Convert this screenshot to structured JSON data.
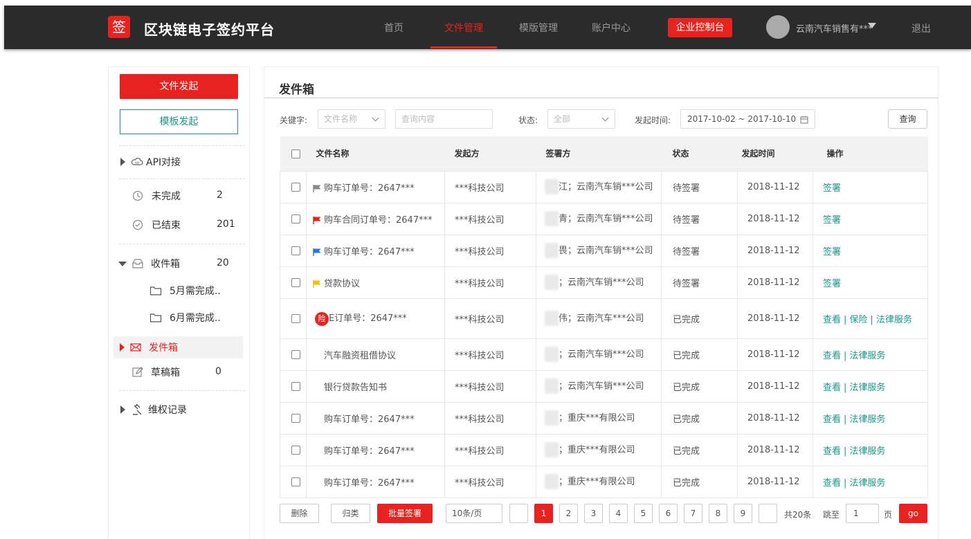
{
  "header": {
    "logo_char": "签",
    "brand": "区块链电子签约平台",
    "nav": [
      {
        "label": "首页",
        "active": false
      },
      {
        "label": "文件管理",
        "active": true
      },
      {
        "label": "模版管理",
        "active": false
      },
      {
        "label": "账户中心",
        "active": false
      }
    ],
    "control_button": "企业控制台",
    "user_name": "云南汽车销售有***",
    "logout": "退出"
  },
  "sidebar": {
    "start_button": "文件发起",
    "template_button": "模板发起",
    "api": "API对接",
    "unfinished": {
      "label": "未完成",
      "count": "2"
    },
    "finished": {
      "label": "已结束",
      "count": "201"
    },
    "inbox": {
      "label": "收件箱",
      "count": "20"
    },
    "folders": [
      "5月需完成..",
      "6月需完成.."
    ],
    "outbox": {
      "label": "发件箱"
    },
    "drafts": {
      "label": "草稿箱",
      "count": "0"
    },
    "rights": "维权记录"
  },
  "main": {
    "title": "发件箱",
    "filters": {
      "keyword_label": "关键字:",
      "keyword_type_placeholder": "文件名称",
      "query_placeholder": "查询内容",
      "status_label": "状态:",
      "status_value": "全部",
      "date_label": "发起时间:",
      "date_value": "2017-10-02 ~ 2017-10-10",
      "query_button": "查询"
    },
    "table": {
      "headers": [
        "文件名称",
        "发起方",
        "签署方",
        "状态",
        "发起时间",
        "操作"
      ],
      "rows": [
        {
          "flag": "#888888",
          "name": "购车订单号：2647***",
          "initiator": "***科技公司",
          "signer": "江；云南汽车销***公司",
          "status": "待签署",
          "date": "2018-11-12",
          "actions": [
            "签署"
          ]
        },
        {
          "flag": "#e8231f",
          "name": "购车合同订单号：2647***",
          "initiator": "***科技公司",
          "signer": "青；云南汽车销***公司",
          "status": "待签署",
          "date": "2018-11-12",
          "actions": [
            "签署"
          ]
        },
        {
          "flag": "#2a72e8",
          "name": "购车订单号：2647***",
          "initiator": "***科技公司",
          "signer": "畏；云南汽车销***公司",
          "status": "待签署",
          "date": "2018-11-12",
          "actions": [
            "签署"
          ]
        },
        {
          "flag": "#f2c200",
          "name": "贷款协议",
          "initiator": "***科技公司",
          "signer": "；云南汽车销***公司",
          "status": "待签署",
          "date": "2018-11-12",
          "actions": [
            "签署"
          ]
        },
        {
          "flag": "",
          "seal": "险",
          "name": "E订单号：2647***",
          "initiator": "***科技公司",
          "signer": "伟；云南汽车***公司",
          "status": "已完成",
          "date": "2018-11-12",
          "actions": [
            "查看",
            "保险",
            "法律服务"
          ]
        },
        {
          "flag": "",
          "name": "汽车融资租借协议",
          "initiator": "***科技公司",
          "signer": "；云南汽车销***公司",
          "status": "已完成",
          "date": "2018-11-12",
          "actions": [
            "查看",
            "法律服务"
          ]
        },
        {
          "flag": "",
          "name": "银行贷款告知书",
          "initiator": "***科技公司",
          "signer": "；云南汽车销***公司",
          "status": "已完成",
          "date": "2018-11-12",
          "actions": [
            "查看",
            "法律服务"
          ]
        },
        {
          "flag": "",
          "name": "购车订单号：2647***",
          "initiator": "***科技公司",
          "signer": "；重庆***有限公司",
          "status": "已完成",
          "date": "2018-11-12",
          "actions": [
            "查看",
            "法律服务"
          ]
        },
        {
          "flag": "",
          "name": "购车订单号：2647***",
          "initiator": "***科技公司",
          "signer": "；重庆***有限公司",
          "status": "已完成",
          "date": "2018-11-12",
          "actions": [
            "查看",
            "法律服务"
          ]
        },
        {
          "flag": "",
          "name": "购车订单号：2647***",
          "initiator": "***科技公司",
          "signer": "；重庆***有限公司",
          "status": "已完成",
          "date": "2018-11-12",
          "actions": [
            "查看",
            "法律服务"
          ]
        }
      ]
    },
    "footer": {
      "delete": "删除",
      "archive": "归类",
      "batch_sign": "批量签署",
      "page_size": "10条/页",
      "pages": [
        "1",
        "2",
        "3",
        "4",
        "5",
        "6",
        "7",
        "8",
        "9"
      ],
      "current_page": "1",
      "total": "共20条",
      "jump_label": "跳至",
      "jump_value": "1",
      "page_unit": "页",
      "go": "go"
    }
  },
  "colors": {
    "accent": "#e8231f",
    "teal": "#189a8c",
    "header_bg": "#2b2b2b"
  }
}
